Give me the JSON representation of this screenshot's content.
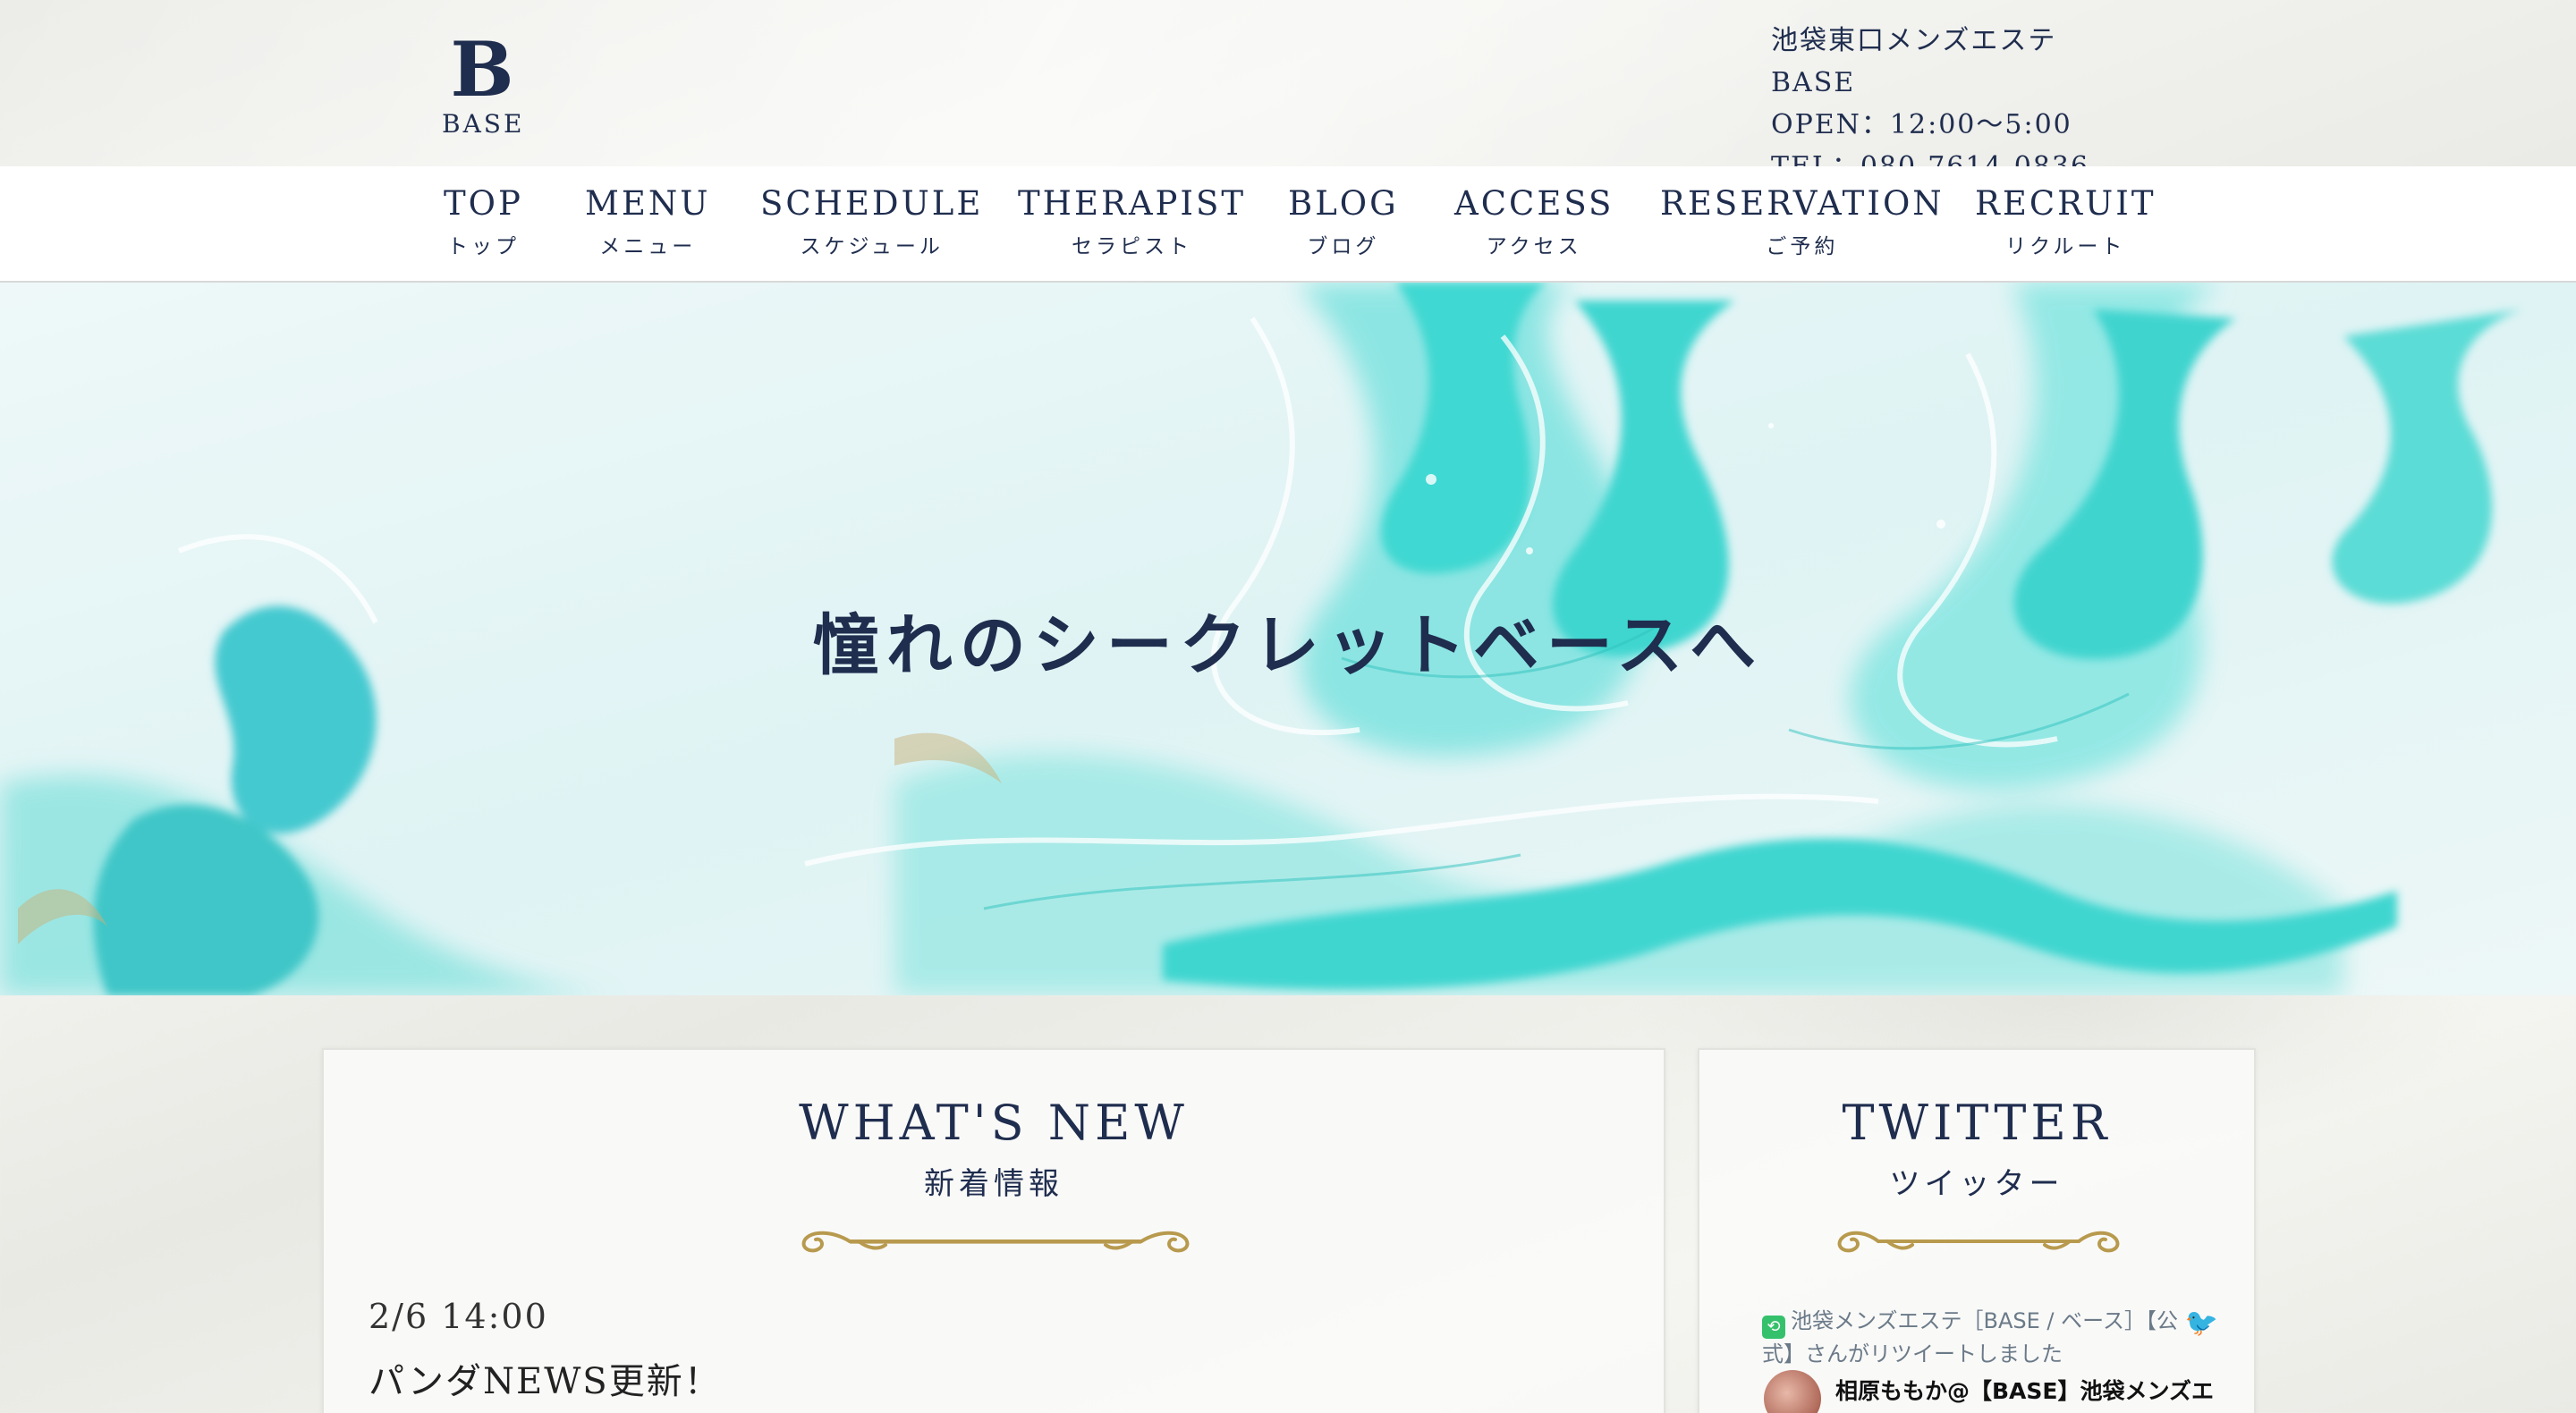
{
  "header": {
    "logo_mark": "B",
    "logo_text": "BASE",
    "shop_name": "池袋東口メンズエステ BASE",
    "open_hours": "OPEN：12:00〜5:00",
    "tel": "TEL：080-7614-0836"
  },
  "nav": {
    "items": [
      {
        "en": "TOP",
        "ja": "トップ"
      },
      {
        "en": "MENU",
        "ja": "メニュー"
      },
      {
        "en": "SCHEDULE",
        "ja": "スケジュール"
      },
      {
        "en": "THERAPIST",
        "ja": "セラピスト"
      },
      {
        "en": "BLOG",
        "ja": "ブログ"
      },
      {
        "en": "ACCESS",
        "ja": "アクセス"
      },
      {
        "en": "RESERVATION",
        "ja": "ご予約"
      },
      {
        "en": "RECRUIT",
        "ja": "リクルート"
      }
    ]
  },
  "hero": {
    "tagline": "憧れのシークレットベースへ"
  },
  "news": {
    "title": "WHAT'S NEW",
    "subtitle": "新着情報",
    "items": [
      {
        "date": "2/6 14:00",
        "title": "パンダNEWS更新！"
      }
    ]
  },
  "twitter": {
    "title": "TWITTER",
    "subtitle": "ツイッター",
    "retweet_text": "池袋メンズエステ［BASE / ベース］【公式】さんがリツイートしました",
    "user_name": "相原ももか@【BASE】池袋メンズエ"
  },
  "colors": {
    "navy": "#1f2d4e",
    "gold": "#b89a4e",
    "turquoise": "#3fd8d2"
  }
}
